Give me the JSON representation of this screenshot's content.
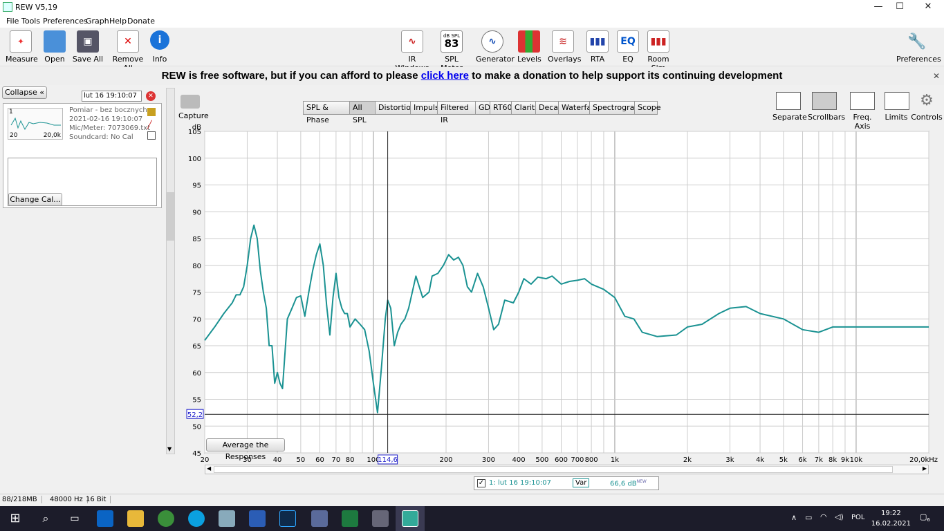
{
  "window": {
    "title": "REW V5,19",
    "minimize": "—",
    "maximize": "☐",
    "close": "✕"
  },
  "menu": [
    "File",
    "Tools",
    "Preferences",
    "Graph",
    "Help",
    "Donate"
  ],
  "toolbar": {
    "left": [
      "Measure",
      "Open",
      "Save All",
      "Remove All",
      "Info"
    ],
    "center": [
      "IR Windows",
      "SPL Meter",
      "Generator",
      "Levels",
      "Overlays",
      "RTA",
      "EQ",
      "Room Sim"
    ],
    "spl_badge": {
      "unit": "dB SPL",
      "value": "83"
    },
    "right": "Preferences"
  },
  "donate": {
    "before": "REW is free software, but if you can afford to please",
    "link": "click here",
    "after": "to make a donation to help support its continuing development"
  },
  "panel": {
    "collapse": "Collapse",
    "name_field": "lut 16 19:10:07",
    "meas_index": "1",
    "thumb_left": "20",
    "thumb_right": "20,0k",
    "info": [
      "Pomiar - bez bocznych.r",
      "2021-02-16 19:10:07",
      "Mic/Meter: 7073069.txt",
      "Soundcard: No Cal"
    ],
    "change_cal": "Change Cal..."
  },
  "graph_tabs": [
    "SPL & Phase",
    "All SPL",
    "Distortion",
    "Impulse",
    "Filtered IR",
    "GD",
    "RT60",
    "Clarity",
    "Decay",
    "Waterfall",
    "Spectrogram",
    "Scope"
  ],
  "active_tab": "All SPL",
  "capture": "Capture",
  "right_tools": [
    "Separate",
    "Scrollbars",
    "Freq. Axis",
    "Limits",
    "Controls"
  ],
  "average_button": "Average the Responses",
  "legend": {
    "label": "1: lut 16 19:10:07",
    "var": "Var",
    "value": "66,6 dB",
    "sup": "NEW"
  },
  "status": [
    "88/218MB",
    "48000 Hz",
    "16 Bit"
  ],
  "taskbar": {
    "lang": "POL",
    "time": "19:22",
    "date": "16.02.2021",
    "notif": "6"
  },
  "colors": {
    "trace": "#1a9292",
    "accent": "#0000ee",
    "cursor_label": "#2222cc"
  },
  "chart_data": {
    "type": "line",
    "x_scale": "log",
    "ylabel": "dB",
    "xunit": "Hz",
    "xlim": [
      20,
      20000
    ],
    "ylim": [
      45,
      105
    ],
    "yticks": [
      105,
      100,
      95,
      90,
      85,
      80,
      75,
      70,
      65,
      60,
      55,
      50,
      45
    ],
    "xticks": [
      {
        "v": 20,
        "l": "20"
      },
      {
        "v": 30,
        "l": "30"
      },
      {
        "v": 40,
        "l": "40"
      },
      {
        "v": 50,
        "l": "50"
      },
      {
        "v": 60,
        "l": "60"
      },
      {
        "v": 70,
        "l": "70"
      },
      {
        "v": 80,
        "l": "80"
      },
      {
        "v": 100,
        "l": "100"
      },
      {
        "v": 200,
        "l": "200"
      },
      {
        "v": 300,
        "l": "300"
      },
      {
        "v": 400,
        "l": "400"
      },
      {
        "v": 500,
        "l": "500"
      },
      {
        "v": 600,
        "l": "600"
      },
      {
        "v": 700,
        "l": "700"
      },
      {
        "v": 800,
        "l": "800"
      },
      {
        "v": 1000,
        "l": "1k"
      },
      {
        "v": 2000,
        "l": "2k"
      },
      {
        "v": 3000,
        "l": "3k"
      },
      {
        "v": 4000,
        "l": "4k"
      },
      {
        "v": 5000,
        "l": "5k"
      },
      {
        "v": 6000,
        "l": "6k"
      },
      {
        "v": 7000,
        "l": "7k"
      },
      {
        "v": 8000,
        "l": "8k"
      },
      {
        "v": 9000,
        "l": "9k"
      },
      {
        "v": 10000,
        "l": "10k"
      },
      {
        "v": 20000,
        "l": "20,0kHz"
      }
    ],
    "cursor": {
      "x": 114.6,
      "y": 52.2,
      "x_label": "114,6",
      "y_label": "52,2"
    },
    "series": [
      {
        "x": [
          20,
          22,
          24,
          26,
          27,
          28,
          29,
          30,
          31,
          32,
          33,
          34,
          35,
          36,
          37,
          38,
          39,
          40,
          41,
          42,
          44,
          46,
          48,
          50,
          52,
          54,
          56,
          58,
          60,
          62,
          64,
          66,
          68,
          70,
          72,
          74,
          76,
          78,
          80,
          84,
          88,
          92,
          96,
          100,
          104,
          108,
          112,
          114.6,
          118,
          122,
          126,
          130,
          135,
          140,
          150,
          160,
          170,
          175,
          185,
          195,
          205,
          215,
          225,
          235,
          245,
          255,
          270,
          285,
          300,
          315,
          330,
          350,
          380,
          400,
          420,
          450,
          480,
          520,
          550,
          600,
          650,
          700,
          750,
          800,
          900,
          1000,
          1100,
          1200,
          1300,
          1500,
          1800,
          2000,
          2300,
          2700,
          3000,
          3500,
          4000,
          5000,
          6000,
          7000,
          8000,
          9000,
          10000,
          12000,
          14000,
          16000,
          20000
        ],
        "y": [
          66,
          68.5,
          71,
          73,
          74.5,
          74.5,
          76,
          80,
          85,
          87.5,
          85,
          79,
          75,
          72,
          65,
          65,
          58,
          60,
          58,
          57,
          70,
          72,
          74,
          74.3,
          70.5,
          75,
          79,
          82,
          84,
          80,
          72.5,
          67,
          74,
          78.5,
          74,
          72,
          71,
          71,
          68.5,
          70,
          69,
          68,
          64,
          58,
          52.5,
          61,
          70,
          73.5,
          72,
          65,
          67.5,
          69,
          70,
          72,
          78,
          74,
          75,
          78,
          78.5,
          80,
          82,
          81,
          81.5,
          80,
          76,
          75,
          78.5,
          76,
          72,
          68,
          69,
          73.5,
          73,
          75,
          77.5,
          76.5,
          77.8,
          77.5,
          78,
          76.5,
          77,
          77.2,
          77.5,
          76.5,
          75.5,
          74,
          70.5,
          70,
          67.5,
          66.7,
          67,
          68.5,
          69,
          71,
          72,
          72.3,
          71,
          70,
          68,
          67.5,
          68.5,
          68.5,
          68.5,
          68.5,
          68.5,
          68.5,
          68.5
        ]
      }
    ]
  }
}
